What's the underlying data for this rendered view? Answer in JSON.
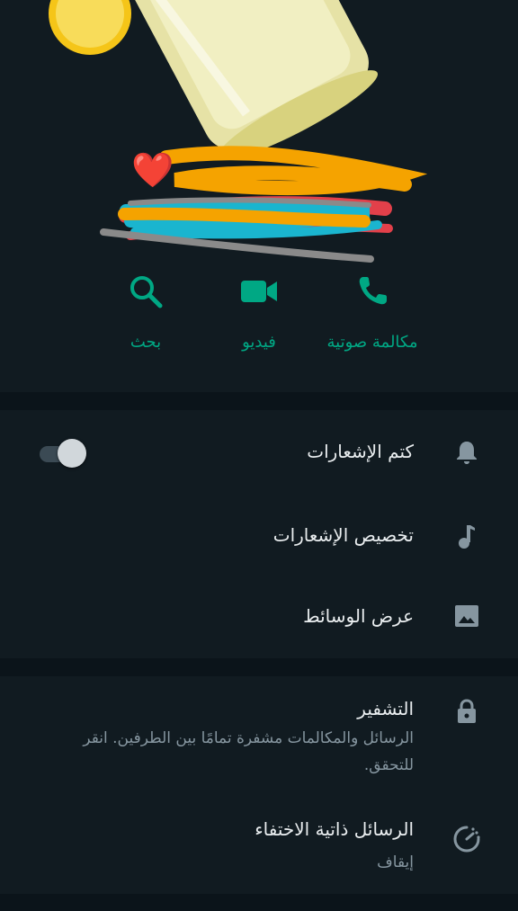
{
  "profile": {
    "name": "",
    "name_emoji": "❤️"
  },
  "actions": {
    "voice_call_label": "مكالمة صوتية",
    "video_label": "فيديو",
    "search_label": "بحث"
  },
  "settings": {
    "mute_notifications": {
      "label": "كتم الإشعارات",
      "enabled": false
    },
    "custom_notifications": {
      "label": "تخصيص الإشعارات"
    },
    "media_visibility": {
      "label": "عرض الوسائط"
    }
  },
  "security": {
    "encryption": {
      "title": "التشفير",
      "subtitle": "الرسائل والمكالمات مشفرة تمامًا بين الطرفين. انقر للتحقق."
    },
    "disappearing_messages": {
      "title": "الرسائل ذاتية الاختفاء",
      "status": "إيقاف"
    }
  },
  "colors": {
    "accent": "#00a884",
    "background": "#111b21",
    "separator": "#0b141a",
    "secondary_text": "#8696a0"
  }
}
